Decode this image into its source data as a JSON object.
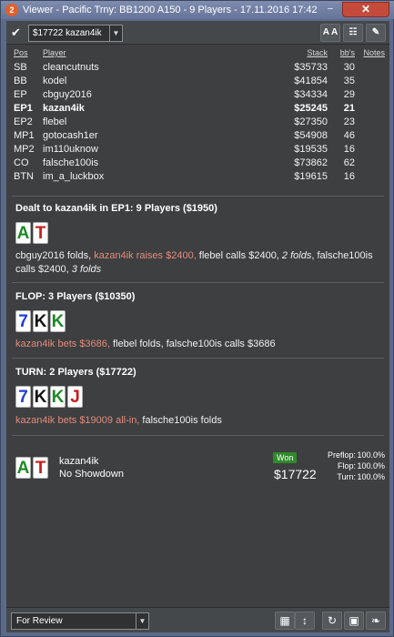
{
  "window": {
    "app_icon": "2",
    "title": "Viewer - Pacific Trny: BB1200 A150 - 9 Players - 17.11.2016 17:42",
    "minimize_glyph": "–",
    "close_glyph": "✕"
  },
  "toolbar": {
    "checkbox_glyph": "✔",
    "player_select": {
      "value": "$17722 kazan4ik",
      "arrow": "▼"
    },
    "font_button": "A A",
    "grid_button": "☷",
    "edit_button": "✎"
  },
  "players": {
    "headers": {
      "pos": "Pos",
      "player": "Player",
      "stack": "Stack",
      "bbs": "bb's",
      "notes": "Notes"
    },
    "rows": [
      {
        "pos": "SB",
        "name": "cleancutnuts",
        "stack": "$35733",
        "bbs": "30"
      },
      {
        "pos": "BB",
        "name": "kodel",
        "stack": "$41854",
        "bbs": "35"
      },
      {
        "pos": "EP",
        "name": "cbguy2016",
        "stack": "$34334",
        "bbs": "29"
      },
      {
        "pos": "EP1",
        "name": "kazan4ik",
        "stack": "$25245",
        "bbs": "21"
      },
      {
        "pos": "EP2",
        "name": "flebel",
        "stack": "$27350",
        "bbs": "23"
      },
      {
        "pos": "MP1",
        "name": "gotocash1er",
        "stack": "$54908",
        "bbs": "46"
      },
      {
        "pos": "MP2",
        "name": "im110uknow",
        "stack": "$19535",
        "bbs": "16"
      },
      {
        "pos": "CO",
        "name": "falsche100is",
        "stack": "$73862",
        "bbs": "62"
      },
      {
        "pos": "BTN",
        "name": "im_a_luckbox",
        "stack": "$19615",
        "bbs": "16"
      }
    ]
  },
  "preflop": {
    "title": "Dealt to kazan4ik in EP1: 9 Players ($1950)",
    "cards": [
      "A",
      "T"
    ],
    "action": {
      "a1": "cbguy2016 folds, ",
      "a2": "kazan4ik raises $2400,",
      "a3": " flebel calls $2400, ",
      "a4": "2 folds",
      "a5": ", falsche100is calls $2400, ",
      "a6": "3 folds"
    }
  },
  "flop": {
    "title": "FLOP: 3 Players ($10350)",
    "cards": [
      "7",
      "K",
      "K"
    ],
    "action": {
      "a1": "kazan4ik bets $3686,",
      "a2": " flebel folds, falsche100is calls $3686"
    }
  },
  "turn": {
    "title": "TURN: 2 Players ($17722)",
    "cards": [
      "7",
      "K",
      "K",
      "J"
    ],
    "action": {
      "a1": "kazan4ik bets $19009 all-in,",
      "a2": " falsche100is folds"
    }
  },
  "summary": {
    "cards": [
      "A",
      "T"
    ],
    "player": "kazan4ik",
    "showdown": "No Showdown",
    "won_label": "Won",
    "won_amount": "$17722",
    "stats": [
      {
        "label": "Preflop:",
        "value": "100.0%"
      },
      {
        "label": "Flop:",
        "value": "100.0%"
      },
      {
        "label": "Turn:",
        "value": "100.0%"
      }
    ]
  },
  "footer": {
    "review_select": {
      "value": "For Review",
      "arrow": "▼"
    },
    "calendar_button": "▦",
    "sort_button": "↕",
    "refresh_button": "↻",
    "save_button": "▣",
    "twitter_button": "❧"
  },
  "colors": {
    "spade": "#111111",
    "heart": "#c81c1c",
    "diamond": "#1d3fd8",
    "club": "#1d8a26",
    "highlight": "#e58a7a",
    "won": "#2f8a2a"
  }
}
